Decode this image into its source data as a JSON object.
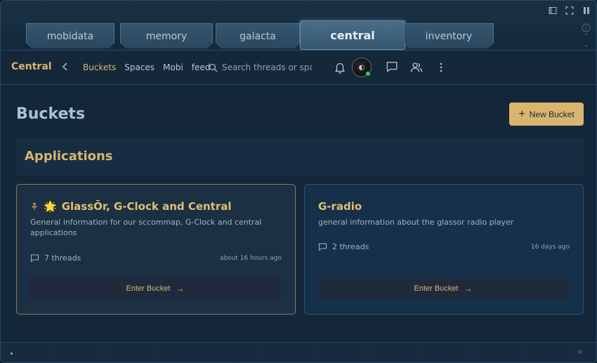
{
  "app_tabs": [
    {
      "label": "mobidata",
      "active": false
    },
    {
      "label": "memory",
      "active": false
    },
    {
      "label": "galacta",
      "active": false
    },
    {
      "label": "central",
      "active": true
    },
    {
      "label": "inventory",
      "active": false
    }
  ],
  "header": {
    "brand": "Central",
    "nav": [
      {
        "label": "Buckets",
        "active": true
      },
      {
        "label": "Spaces",
        "active": false
      },
      {
        "label": "Mobi",
        "active": false
      },
      {
        "label": "feed",
        "active": false
      }
    ],
    "search_placeholder": "Search threads or spaces..."
  },
  "page": {
    "title": "Buckets",
    "new_button": "New Bucket",
    "section_title": "Applications"
  },
  "cards": [
    {
      "pinned": true,
      "emoji": "🌟",
      "title": "GlassŌr, G-Clock and Central",
      "description": "General information for our sccommap, G-Clock and central applications",
      "threads": "7 threads",
      "time": "about 16 hours ago",
      "button": "Enter Bucket"
    },
    {
      "pinned": false,
      "emoji": "",
      "title": "G-radio",
      "description": "general information about the glassor radio player",
      "threads": "2 threads",
      "time": "16 days ago",
      "button": "Enter Bucket"
    }
  ],
  "colors": {
    "accent": "#d9b56f",
    "status_online": "#3fc46a"
  }
}
